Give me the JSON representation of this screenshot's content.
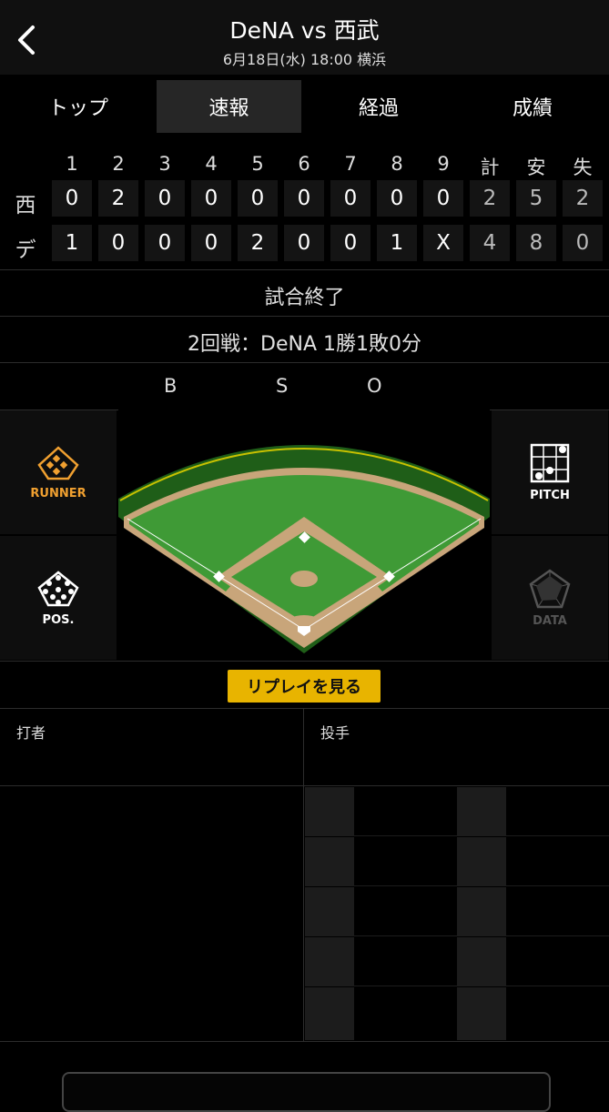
{
  "header": {
    "title": "DeNA vs 西武",
    "subtitle": "6月18日(水) 18:00 横浜"
  },
  "tabs": [
    {
      "label": "トップ",
      "active": false
    },
    {
      "label": "速報",
      "active": true
    },
    {
      "label": "経過",
      "active": false
    },
    {
      "label": "成績",
      "active": false
    }
  ],
  "scoreboard": {
    "columns": [
      "1",
      "2",
      "3",
      "4",
      "5",
      "6",
      "7",
      "8",
      "9",
      "計",
      "安",
      "失"
    ],
    "rows": [
      {
        "team": "西",
        "values": [
          "0",
          "2",
          "0",
          "0",
          "0",
          "0",
          "0",
          "0",
          "0",
          "2",
          "5",
          "2"
        ]
      },
      {
        "team": "デ",
        "values": [
          "1",
          "0",
          "0",
          "0",
          "2",
          "0",
          "0",
          "1",
          "X",
          "4",
          "8",
          "0"
        ]
      }
    ]
  },
  "status": "試合終了",
  "series": "2回戦：DeNA 1勝1敗0分",
  "count": {
    "b": "B",
    "s": "S",
    "o": "O"
  },
  "side_buttons": {
    "runner": "RUNNER",
    "pos": "POS.",
    "pitch": "PITCH",
    "data": "DATA"
  },
  "replay_label": "リプレイを見る",
  "batter_label": "打者",
  "pitcher_label": "投手",
  "colors": {
    "accent": "#e8b400",
    "runner": "#f0a030",
    "field_grass": "#3f9a36",
    "field_dirt": "#c8a57a"
  }
}
